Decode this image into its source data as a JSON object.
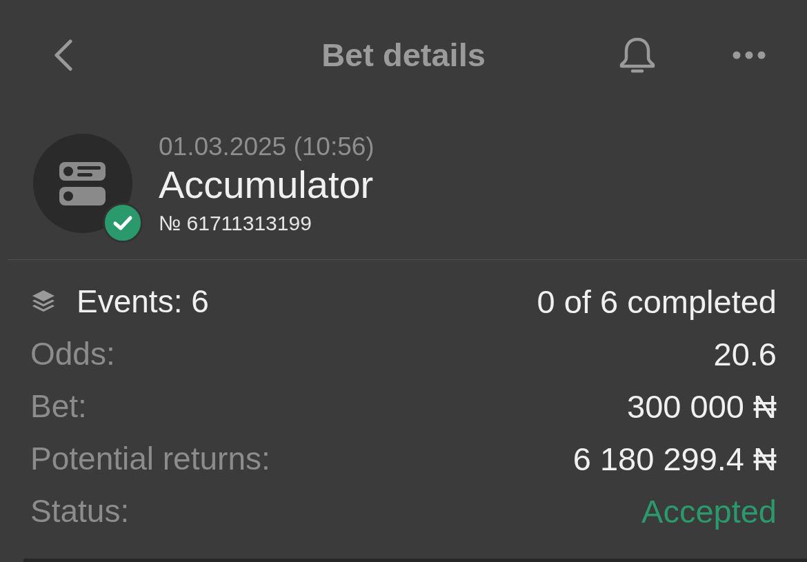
{
  "header": {
    "title": "Bet details"
  },
  "bet": {
    "date": "01.03.2025 (10:56)",
    "type": "Accumulator",
    "number": "№ 61711313199"
  },
  "events": {
    "label": "Events: 6",
    "summary": "0 of 6 completed"
  },
  "details": [
    {
      "kind": "value",
      "label": "Odds:",
      "value": "20.6"
    },
    {
      "kind": "value",
      "label": "Bet:",
      "value": "300 000 ₦"
    },
    {
      "kind": "value",
      "label": "Potential returns:",
      "value": "6 180 299.4 ₦"
    },
    {
      "kind": "status",
      "label": "Status:",
      "value": "Accepted"
    }
  ]
}
